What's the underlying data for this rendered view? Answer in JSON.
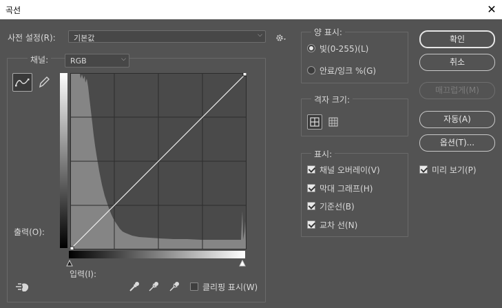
{
  "window": {
    "title": "곡선",
    "close_symbol": "✕"
  },
  "preset": {
    "label": "사전 설정(R):",
    "value": "기본값"
  },
  "channel": {
    "label": "채널:",
    "value": "RGB"
  },
  "curve_panel": {
    "output_label": "출력(O):",
    "input_label": "입력(I):",
    "clipping_label": "클리핑 표시(W)",
    "clipping_checked": false,
    "curve_points": [
      [
        0,
        0
      ],
      [
        255,
        255
      ]
    ]
  },
  "amount_display": {
    "title": "양 표시:",
    "options": [
      {
        "label": "빛(0-255)(L)",
        "selected": true
      },
      {
        "label": "안료/잉크 %(G)",
        "selected": false
      }
    ]
  },
  "grid_size": {
    "title": "격자 크기:"
  },
  "show": {
    "title": "표시:",
    "items": [
      {
        "label": "채널 오버레이(V)",
        "checked": true
      },
      {
        "label": "막대 그래프(H)",
        "checked": true
      },
      {
        "label": "기준선(B)",
        "checked": true
      },
      {
        "label": "교차 선(N)",
        "checked": true
      }
    ]
  },
  "buttons": {
    "ok": "확인",
    "cancel": "취소",
    "smooth": "매끄럽게(M)",
    "auto": "자동(A)",
    "options": "옵션(T)..."
  },
  "preview": {
    "label": "미리 보기(P)",
    "checked": true
  },
  "colors": {
    "background": "#535353",
    "graph_bg": "#4a4a4a",
    "histogram": "#888888",
    "grid": "#2b2b2b"
  }
}
